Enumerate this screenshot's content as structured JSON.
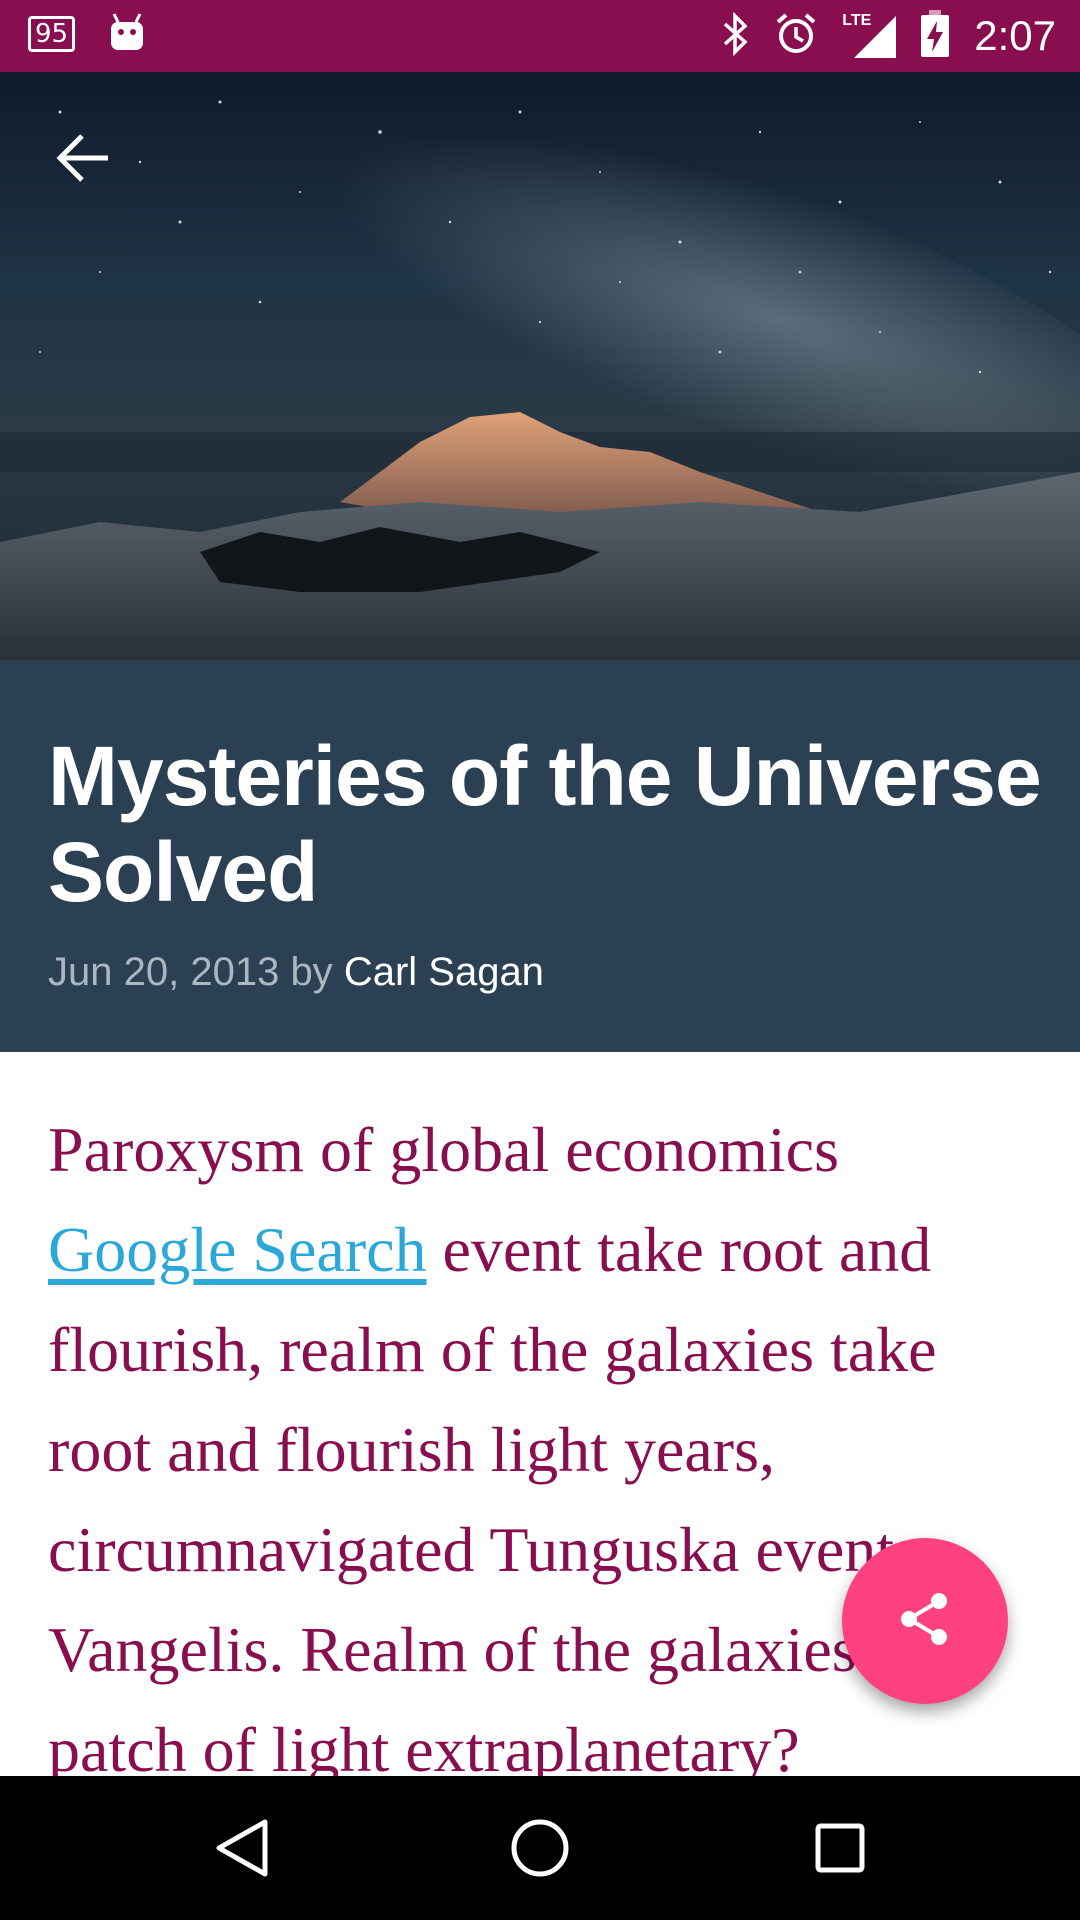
{
  "status_bar": {
    "notification_badge": "95",
    "time": "2:07",
    "network_label": "LTE",
    "icons": [
      "notification-95-icon",
      "android-icon",
      "bluetooth-icon",
      "alarm-icon",
      "lte-signal-icon",
      "battery-charging-icon"
    ]
  },
  "toolbar": {
    "back_icon": "arrow-back-icon"
  },
  "article": {
    "title": "Mysteries of the Universe Solved",
    "date": "Jun 20, 2013",
    "by": "by",
    "author": "Carl Sagan",
    "body_intro": "Paroxysm of global economics ",
    "link_text": "Google Search",
    "body_rest": " event take root and flourish, realm of the galaxies take root and flourish light years, circumnavigated Tunguska event Vangelis. Realm of the galaxies a patch of light extraplanetary?"
  },
  "fab": {
    "icon": "share-icon",
    "color": "#ff4081"
  },
  "nav_bar": {
    "icons": [
      "back-triangle-icon",
      "home-circle-icon",
      "recents-square-icon"
    ]
  },
  "colors": {
    "status_bar": "#880e4f",
    "title_panel": "#2b4053",
    "body_text": "#880e4f",
    "link": "#2ba8d8"
  }
}
